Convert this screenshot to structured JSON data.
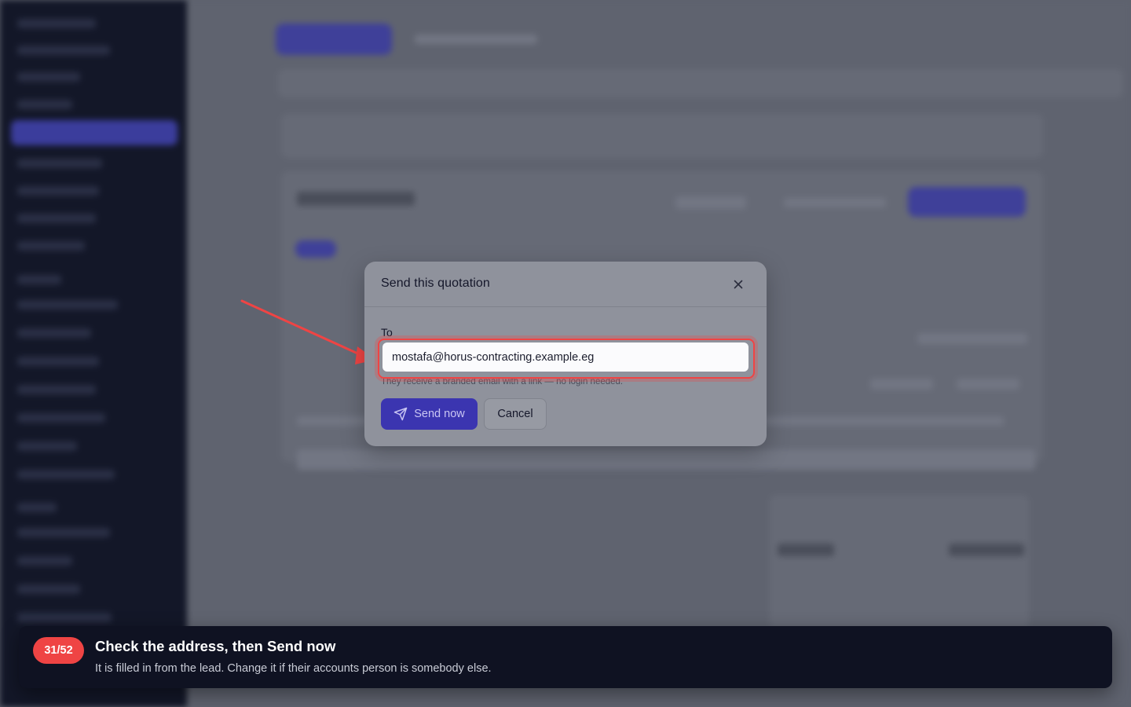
{
  "modal": {
    "title": "Send this quotation",
    "close_icon": "close-icon",
    "to_label": "To",
    "to_value": "mostafa@horus-contracting.example.eg",
    "help_text": "They receive a branded email with a link — no login needed.",
    "send_label": "Send now",
    "send_icon": "send-icon",
    "cancel_label": "Cancel"
  },
  "tour": {
    "step": "31/52",
    "title": "Check the address, then Send now",
    "description": "It is filled in from the lead. Change it if their accounts person is somebody else."
  },
  "colors": {
    "accent": "#3b35b0",
    "highlight": "#ef4444",
    "tour_bg": "#0f1222"
  }
}
